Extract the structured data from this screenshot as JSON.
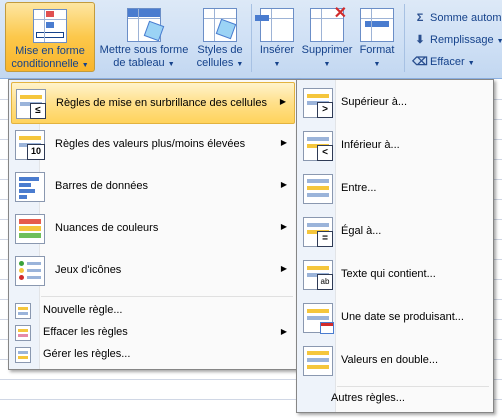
{
  "ribbon": {
    "mise_en_forme": {
      "line1": "Mise en forme",
      "line2": "conditionnelle"
    },
    "mettre_tableau": {
      "line1": "Mettre sous forme",
      "line2": "de tableau"
    },
    "styles_cellules": {
      "line1": "Styles de",
      "line2": "cellules"
    },
    "inserer": "Insérer",
    "supprimer": "Supprimer",
    "format": "Format",
    "somme_auto": "Somme autom",
    "remplissage": "Remplissage",
    "effacer": "Effacer"
  },
  "menu": {
    "items": [
      {
        "label": "Règles de mise en surbrillance des cellules",
        "highlighted": true,
        "has_submenu": true
      },
      {
        "label": "Règles des valeurs plus/moins élevées",
        "has_submenu": true
      },
      {
        "label": "Barres de données",
        "has_submenu": true
      },
      {
        "label": "Nuances de couleurs",
        "has_submenu": true
      },
      {
        "label": "Jeux d'icônes",
        "has_submenu": true
      }
    ],
    "small_items": [
      {
        "label": "Nouvelle règle...",
        "has_submenu": false
      },
      {
        "label": "Effacer les règles",
        "has_submenu": true
      },
      {
        "label": "Gérer les règles...",
        "has_submenu": false
      }
    ]
  },
  "submenu": {
    "items": [
      {
        "label": "Supérieur à...",
        "badge": ">"
      },
      {
        "label": "Inférieur à...",
        "badge": "<"
      },
      {
        "label": "Entre...",
        "badge": ""
      },
      {
        "label": "Égal à...",
        "badge": "="
      },
      {
        "label": "Texte qui contient...",
        "badge": "ab"
      },
      {
        "label": "Une date se produisant...",
        "badge": ""
      },
      {
        "label": "Valeurs en double...",
        "badge": ""
      }
    ],
    "more": "Autres règles..."
  },
  "colors": {
    "ribbon_bg": "#cfe0f5",
    "highlight": "#ffe08a",
    "highlight_border": "#e3b33f",
    "text_ribbon": "#15428b"
  }
}
